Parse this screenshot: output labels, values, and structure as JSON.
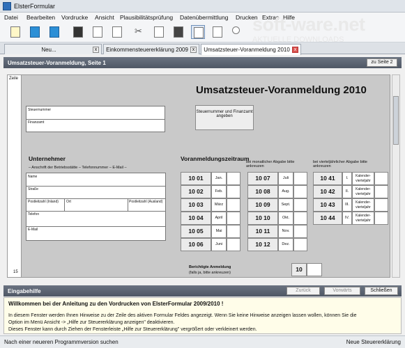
{
  "window": {
    "title": "ElsterFormular"
  },
  "menu": [
    "Datei",
    "Bearbeiten",
    "Vordrucke",
    "Ansicht",
    "Plausibilitätsprüfung",
    "Datenübermittlung",
    "Drucken",
    "Extras",
    "Hilfe"
  ],
  "watermark": {
    "text": "soft-ware.net",
    "sub": "AKTUELLE DOWNLOADS"
  },
  "tabs": [
    "Neu...",
    "Einkommensteuererklärung 2009",
    "Umsatzsteuer-Voranmeldung 2010"
  ],
  "tab_close": "x",
  "section": {
    "title": "Umsatzsteuer-Voranmeldung, Seite 1",
    "button": "zu Seite 2"
  },
  "form": {
    "zeile": "Zeile",
    "zeile_num": "15",
    "title": "Umsatzsteuer-Voranmeldung 2010",
    "steuernummer": "Steuernummer",
    "finanzamt": "Finanzamt",
    "sf_button": "Steuernummer und Finanzamt angeben",
    "unternehmer": "Unternehmer",
    "anschrift": "– Anschrift der Betriebsstätte – Telefonnummer – E-Mail –",
    "name": "Name",
    "strasse": "Straße",
    "plz_inland": "Postleitzahl (Inland)",
    "ort": "Ort",
    "plz_ausland": "Postleitzahl (Ausland)",
    "telefon": "Telefon",
    "email": "E-Mail",
    "vzr_title": "Voranmeldungszeitraum",
    "monthly_hint": "bei monatlicher Abgabe bitte ankreuzen",
    "quarterly_hint": "bei vierteljährlicher Abgabe bitte ankreuzen",
    "codes_col1": [
      "10 01",
      "10 02",
      "10 03",
      "10 04",
      "10 05",
      "10 06"
    ],
    "months_col1": [
      "Jan.",
      "Feb.",
      "März",
      "April",
      "Mai",
      "Juni"
    ],
    "codes_col2": [
      "10 07",
      "10 08",
      "10 09",
      "10 10",
      "10 11",
      "10 12"
    ],
    "months_col2": [
      "Juli",
      "Aug.",
      "Sept.",
      "Okt.",
      "Nov.",
      "Dez."
    ],
    "codes_q": [
      "10 41",
      "10 42",
      "10 43",
      "10 44"
    ],
    "roman_q": [
      "I.",
      "II.",
      "III.",
      "IV."
    ],
    "q_label": "Kalender-vierteljahr",
    "berichtigt": "Berichtigte Anmeldung",
    "berichtigt_sub": "(falls ja, bitte ankreuzen)",
    "berichtigt_code": "10"
  },
  "eingabe": {
    "title": "Eingabehilfe",
    "zurueck": "Zurück",
    "vorwaerts": "Vorwärts",
    "schliessen": "Schließen"
  },
  "help": {
    "heading": "Willkommen bei der Anleitung zu den Vordrucken von ElsterFormular 2009/2010 !",
    "lines": [
      "In diesem Fenster werden Ihnen Hinweise zu der Zeile des aktiven Formular Feldes angezeigt. Wenn Sie keine Hinweise anzeigen lassen wollen, können Sie die",
      "Option im Menü Ansicht -> „Hilfe zur Steuererklärung anzeigen\" deaktivieren.",
      "Dieses Fenster kann durch Ziehen der Fensterleiste „Hilfe zur Steuererklärung\" vergrößert oder verkleinert werden."
    ]
  },
  "status": {
    "left": "Nach einer neueren Programmversion suchen",
    "right": "Neue Steuererklärung"
  }
}
